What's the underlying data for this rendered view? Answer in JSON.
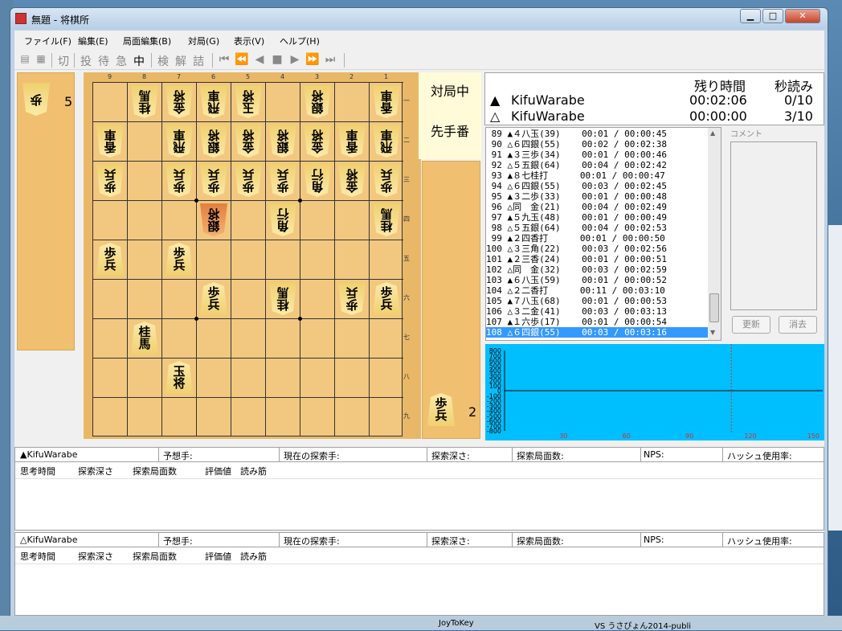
{
  "window": {
    "title": "無題 - 将棋所",
    "minimize": "▁",
    "maximize": "□",
    "close": "✕"
  },
  "menu": [
    "ファイル(F)",
    "編集(E)",
    "局面編集(B)",
    "対局(G)",
    "表示(V)",
    "ヘルプ(H)"
  ],
  "toolbar": [
    "切",
    "投",
    "待",
    "急",
    "中",
    "検",
    "解",
    "詰",
    "⏮",
    "⏪",
    "◀",
    "■",
    "▶",
    "⏩",
    "⏭"
  ],
  "board": {
    "file_labels": [
      "9",
      "8",
      "7",
      "6",
      "5",
      "4",
      "3",
      "2",
      "1"
    ],
    "rank_labels": [
      "一",
      "二",
      "三",
      "四",
      "五",
      "六",
      "七",
      "八",
      "九"
    ],
    "gote_hand": {
      "piece": "歩",
      "count": "5"
    },
    "sente_hand": {
      "piece": "歩",
      "count": "2"
    },
    "pieces": [
      {
        "f": 8,
        "r": 1,
        "t": "桂",
        "g": true
      },
      {
        "f": 7,
        "r": 1,
        "t": "金",
        "g": true
      },
      {
        "f": 6,
        "r": 1,
        "t": "飛",
        "g": true
      },
      {
        "f": 5,
        "r": 1,
        "t": "玉",
        "g": true
      },
      {
        "f": 3,
        "r": 1,
        "t": "銀",
        "g": true
      },
      {
        "f": 1,
        "r": 1,
        "t": "香",
        "g": true
      },
      {
        "f": 9,
        "r": 2,
        "t": "香",
        "g": true
      },
      {
        "f": 7,
        "r": 2,
        "t": "飛",
        "g": true
      },
      {
        "f": 6,
        "r": 2,
        "t": "銀",
        "g": true
      },
      {
        "f": 5,
        "r": 2,
        "t": "金",
        "g": true
      },
      {
        "f": 4,
        "r": 2,
        "t": "銀",
        "g": true
      },
      {
        "f": 3,
        "r": 2,
        "t": "金",
        "g": true
      },
      {
        "f": 2,
        "r": 2,
        "t": "香",
        "g": true
      },
      {
        "f": 1,
        "r": 2,
        "t": "飛",
        "g": true
      },
      {
        "f": 9,
        "r": 3,
        "t": "歩",
        "g": true
      },
      {
        "f": 7,
        "r": 3,
        "t": "歩",
        "g": true
      },
      {
        "f": 6,
        "r": 3,
        "t": "歩",
        "g": true
      },
      {
        "f": 5,
        "r": 3,
        "t": "歩",
        "g": true
      },
      {
        "f": 4,
        "r": 3,
        "t": "歩",
        "g": true
      },
      {
        "f": 3,
        "r": 3,
        "t": "角",
        "g": true
      },
      {
        "f": 2,
        "r": 3,
        "t": "金",
        "g": true
      },
      {
        "f": 1,
        "r": 3,
        "t": "歩",
        "g": true
      },
      {
        "f": 6,
        "r": 4,
        "t": "銀",
        "g": true,
        "hl": true
      },
      {
        "f": 4,
        "r": 4,
        "t": "角",
        "g": true
      },
      {
        "f": 1,
        "r": 4,
        "t": "桂",
        "g": true
      },
      {
        "f": 9,
        "r": 5,
        "t": "歩",
        "g": false
      },
      {
        "f": 7,
        "r": 5,
        "t": "歩",
        "g": false
      },
      {
        "f": 6,
        "r": 6,
        "t": "歩",
        "g": false
      },
      {
        "f": 4,
        "r": 6,
        "t": "桂",
        "g": true
      },
      {
        "f": 2,
        "r": 6,
        "t": "歩",
        "g": true
      },
      {
        "f": 1,
        "r": 6,
        "t": "歩",
        "g": false
      },
      {
        "f": 8,
        "r": 7,
        "t": "桂",
        "g": false
      },
      {
        "f": 7,
        "r": 8,
        "t": "玉",
        "g": false
      }
    ]
  },
  "status": {
    "playing": "対局中",
    "turn": "先手番"
  },
  "clock": {
    "header_remaining": "残り時間",
    "header_byoyomi": "秒読み",
    "sente": {
      "mark": "▲",
      "name": "KifuWarabe",
      "remaining": "00:02:06",
      "byoyomi": "0/10"
    },
    "gote": {
      "mark": "△",
      "name": "KifuWarabe",
      "remaining": "00:00:00",
      "byoyomi": "3/10"
    }
  },
  "moves": [
    " 89 ▲４八玉(39)    00:01 / 00:00:45",
    " 90 △６四銀(55)    00:02 / 00:02:38",
    " 91 ▲３三歩(34)    00:01 / 00:00:46",
    " 92 △５五銀(64)    00:04 / 00:02:42",
    " 93 ▲８七桂打      00:01 / 00:00:47",
    " 94 △６四銀(55)    00:03 / 00:02:45",
    " 95 ▲３二歩(33)    00:01 / 00:00:48",
    " 96 △同　金(21)    00:04 / 00:02:49",
    " 97 ▲５九玉(48)    00:01 / 00:00:49",
    " 98 △５五銀(64)    00:04 / 00:02:53",
    " 99 ▲２四香打      00:01 / 00:00:50",
    "100 △３三角(22)    00:03 / 00:02:56",
    "101 ▲２三香(24)    00:01 / 00:00:51",
    "102 △同　金(32)    00:03 / 00:02:59",
    "103 ▲６八玉(59)    00:01 / 00:00:52",
    "104 △２二香打      00:11 / 00:03:10",
    "105 ▲７八玉(68)    00:01 / 00:00:53",
    "106 △３二金(41)    00:03 / 00:03:13",
    "107 ▲１六歩(17)    00:01 / 00:00:54",
    "108 △６四銀(55)    00:03 / 00:03:16"
  ],
  "comment": {
    "label": "コメント",
    "update": "更新",
    "clear": "消去"
  },
  "graph": {
    "y_ticks": [
      "800",
      "700",
      "600",
      "500",
      "400",
      "300",
      "200",
      "100",
      "0",
      "-100",
      "-200",
      "-300",
      "-400",
      "-500",
      "-600",
      "-700",
      "-800"
    ],
    "x_ticks": [
      "30",
      "60",
      "90",
      "120",
      "150"
    ],
    "colors": {
      "background": "#00bfff",
      "axis": "#000000",
      "marker": "#cc3333"
    }
  },
  "engine_panels": [
    {
      "player": "▲KifuWarabe",
      "labels": [
        "予想手:",
        "現在の探索手:",
        "探索深さ:",
        "探索局面数:",
        "NPS:",
        "ハッシュ使用率:"
      ],
      "columns": [
        "思考時間",
        "探索深さ",
        "探索局面数",
        "評価値",
        "読み筋"
      ]
    },
    {
      "player": "△KifuWarabe",
      "labels": [
        "予想手:",
        "現在の探索手:",
        "探索深さ:",
        "探索局面数:",
        "NPS:",
        "ハッシュ使用率:"
      ],
      "columns": [
        "思考時間",
        "探索深さ",
        "探索局面数",
        "評価値",
        "読み筋"
      ]
    }
  ],
  "taskbar": [
    "JoyToKey",
    "VS うさぴょん2014-publi"
  ]
}
